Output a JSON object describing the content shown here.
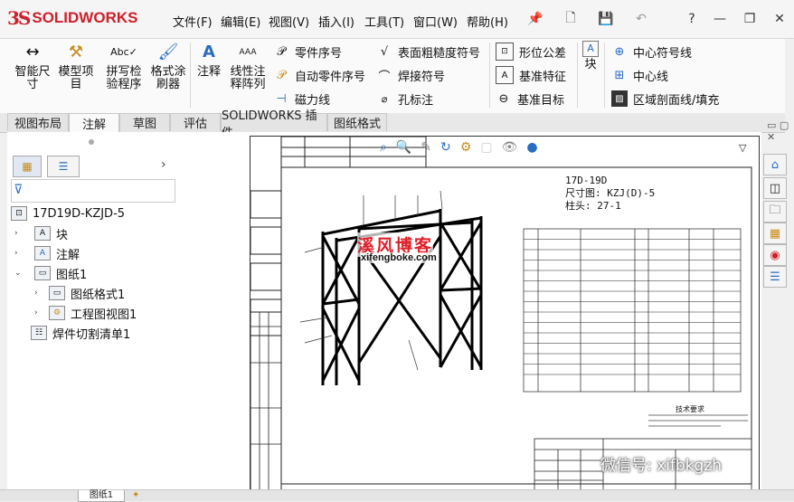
{
  "app": {
    "logo_ds": "3S",
    "logo_name": "SOLIDWORKS"
  },
  "menu": [
    "文件(F)",
    "编辑(E)",
    "视图(V)",
    "插入(I)",
    "工具(T)",
    "窗口(W)",
    "帮助(H)"
  ],
  "ribbon": {
    "big_buttons": [
      {
        "label": "智能尺寸",
        "icon": "smart-dimension-icon"
      },
      {
        "label": "模型项目",
        "icon": "model-items-icon"
      },
      {
        "label": "拼写检验程序",
        "icon": "spell-check-icon"
      },
      {
        "label": "格式涂刷器",
        "icon": "format-painter-icon"
      },
      {
        "label": "注释",
        "icon": "note-icon"
      },
      {
        "label": "线性注释阵列",
        "icon": "linear-pattern-icon"
      }
    ],
    "col1": [
      "零件序号",
      "自动零件序号",
      "磁力线"
    ],
    "col2": [
      "表面粗糙度符号",
      "焊接符号",
      "孔标注"
    ],
    "col3": [
      "形位公差",
      "基准特征",
      "基准目标"
    ],
    "block_label": "块",
    "col4": [
      "中心符号线",
      "中心线",
      "区域剖面线/填充"
    ]
  },
  "tabs": [
    "视图布局",
    "注解",
    "草图",
    "评估",
    "SOLIDWORKS 插件",
    "图纸格式"
  ],
  "active_tab": "注解",
  "tree": {
    "root": "17D19D-KZJD-5",
    "items": [
      {
        "label": "块",
        "level": 1
      },
      {
        "label": "注解",
        "level": 1
      },
      {
        "label": "图纸1",
        "level": 1
      },
      {
        "label": "图纸格式1",
        "level": 2
      },
      {
        "label": "工程图视图1",
        "level": 2
      },
      {
        "label": "焊件切割清单1",
        "level": 1
      }
    ]
  },
  "drawing": {
    "title_lines": [
      "17D-19D",
      "尺寸图: KZJ(D)-5",
      "柱头: 27-1"
    ],
    "tech_title": "技术要求",
    "watermark_top": "溪风博客",
    "watermark_url": "xifengboke.com",
    "bottom_tab": "图纸1"
  },
  "wechat_mark": "微信号: xifbkgzh",
  "colors": {
    "accent_red": "#d0202a",
    "ribbon_bg": "#fafafa",
    "panel_border": "#c8c8c8"
  }
}
